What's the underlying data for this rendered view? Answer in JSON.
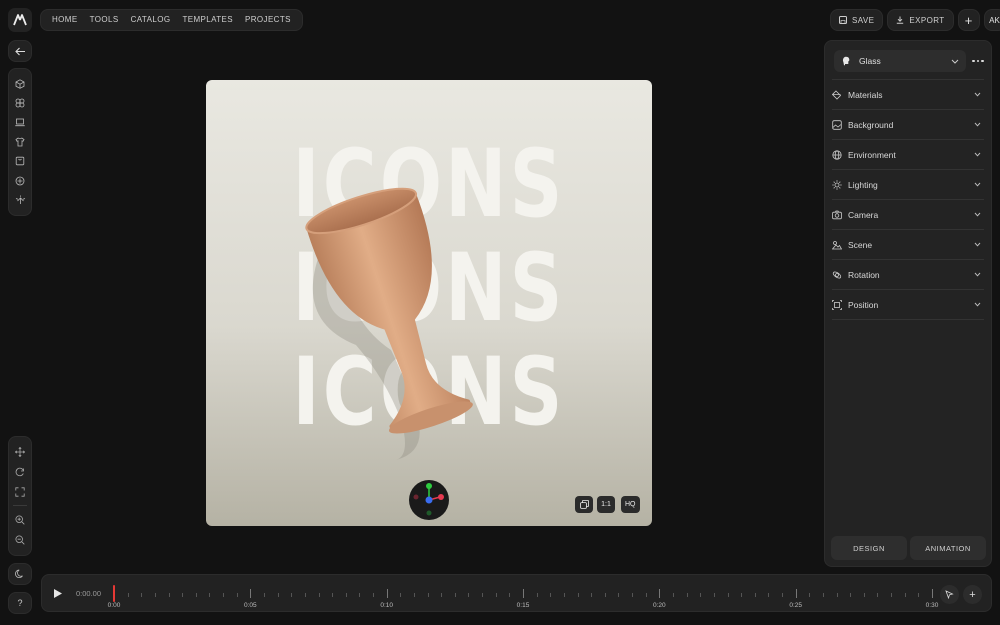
{
  "nav": {
    "items": [
      "HOME",
      "TOOLS",
      "CATALOG",
      "TEMPLATES",
      "PROJECTS"
    ]
  },
  "toolbar": {
    "save_label": "SAVE",
    "export_label": "EXPORT",
    "add_label": "+",
    "avatar_initials": "AK"
  },
  "canvas": {
    "words": [
      "ICONS",
      "ICONS",
      "ICONS"
    ],
    "controls": {
      "ratio_label": "1:1",
      "quality_label": "HQ"
    },
    "colors": {
      "object": "#d9a07c",
      "text": "#f4f3ee"
    }
  },
  "panel": {
    "material_selected": "Glass",
    "sections": [
      "Materials",
      "Background",
      "Environment",
      "Lighting",
      "Camera",
      "Scene",
      "Rotation",
      "Position"
    ],
    "tabs": [
      "DESIGN",
      "ANIMATION"
    ]
  },
  "timeline": {
    "current_time": "0:00.00",
    "labels": [
      "0:00",
      "0:05",
      "0:10",
      "0:15",
      "0:20",
      "0:25",
      "0:30"
    ],
    "playhead_color": "#e53935"
  },
  "help_label": "?"
}
